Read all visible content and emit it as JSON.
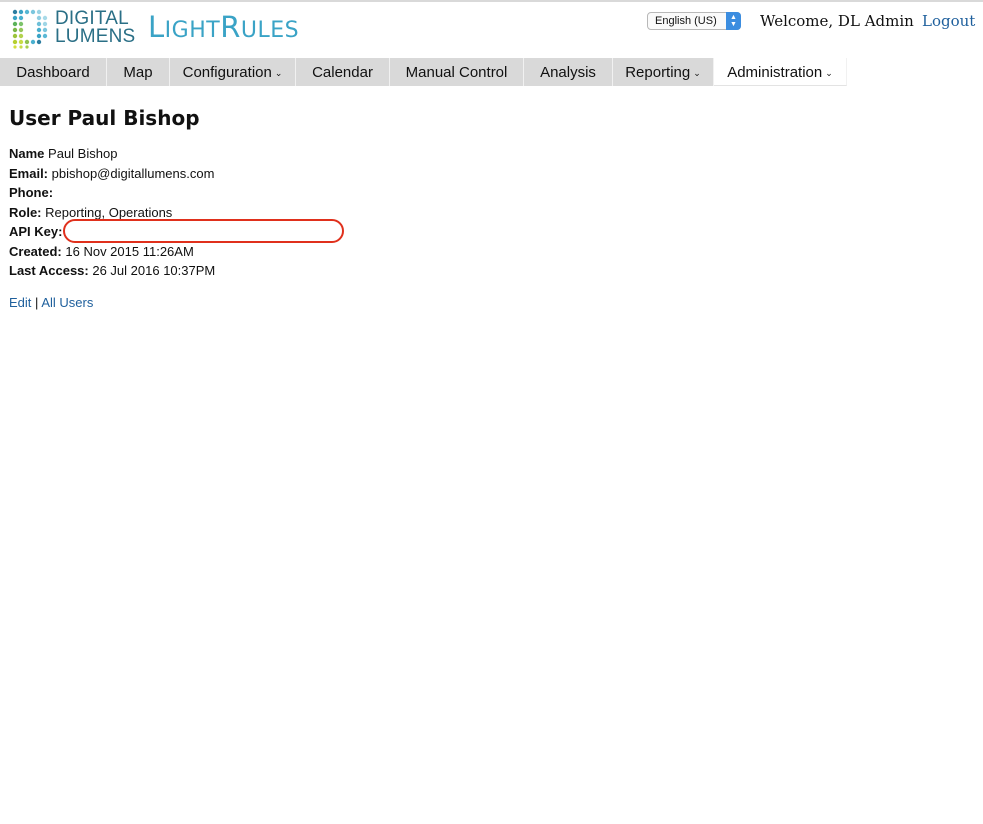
{
  "header": {
    "brand_line1": "DIGITAL",
    "brand_line2": "LUMENS",
    "product_first": "L",
    "product_light": "IGHT",
    "product_r": "R",
    "product_ules": "ULES",
    "language": "English (US)",
    "welcome": "Welcome, DL Admin",
    "logout": "Logout"
  },
  "nav": {
    "items": [
      {
        "label": "Dashboard",
        "dropdown": false
      },
      {
        "label": "Map",
        "dropdown": false
      },
      {
        "label": "Configuration",
        "dropdown": true
      },
      {
        "label": "Calendar",
        "dropdown": false
      },
      {
        "label": "Manual Control",
        "dropdown": false
      },
      {
        "label": "Analysis",
        "dropdown": false
      },
      {
        "label": "Reporting",
        "dropdown": true
      },
      {
        "label": "Administration",
        "dropdown": true,
        "active": true
      }
    ]
  },
  "user": {
    "title": "User Paul Bishop",
    "fields": [
      {
        "label": "Name",
        "value": "Paul Bishop"
      },
      {
        "label": "Email:",
        "value": "pbishop@digitallumens.com"
      },
      {
        "label": "Phone:",
        "value": ""
      },
      {
        "label": "Role:",
        "value": "Reporting, Operations"
      },
      {
        "label": "API Key:",
        "value": ""
      },
      {
        "label": "Created:",
        "value": "16 Nov 2015 11:26AM"
      },
      {
        "label": "Last Access:",
        "value": "26 Jul 2016 10:37PM"
      }
    ]
  },
  "actions": {
    "edit": "Edit",
    "separator": "|",
    "all_users": "All Users"
  },
  "colors": {
    "nav_bg": "#d9d9d9",
    "link": "#1e5f9c",
    "highlight": "#e0301c",
    "brand_teal": "#3aa3c6"
  }
}
